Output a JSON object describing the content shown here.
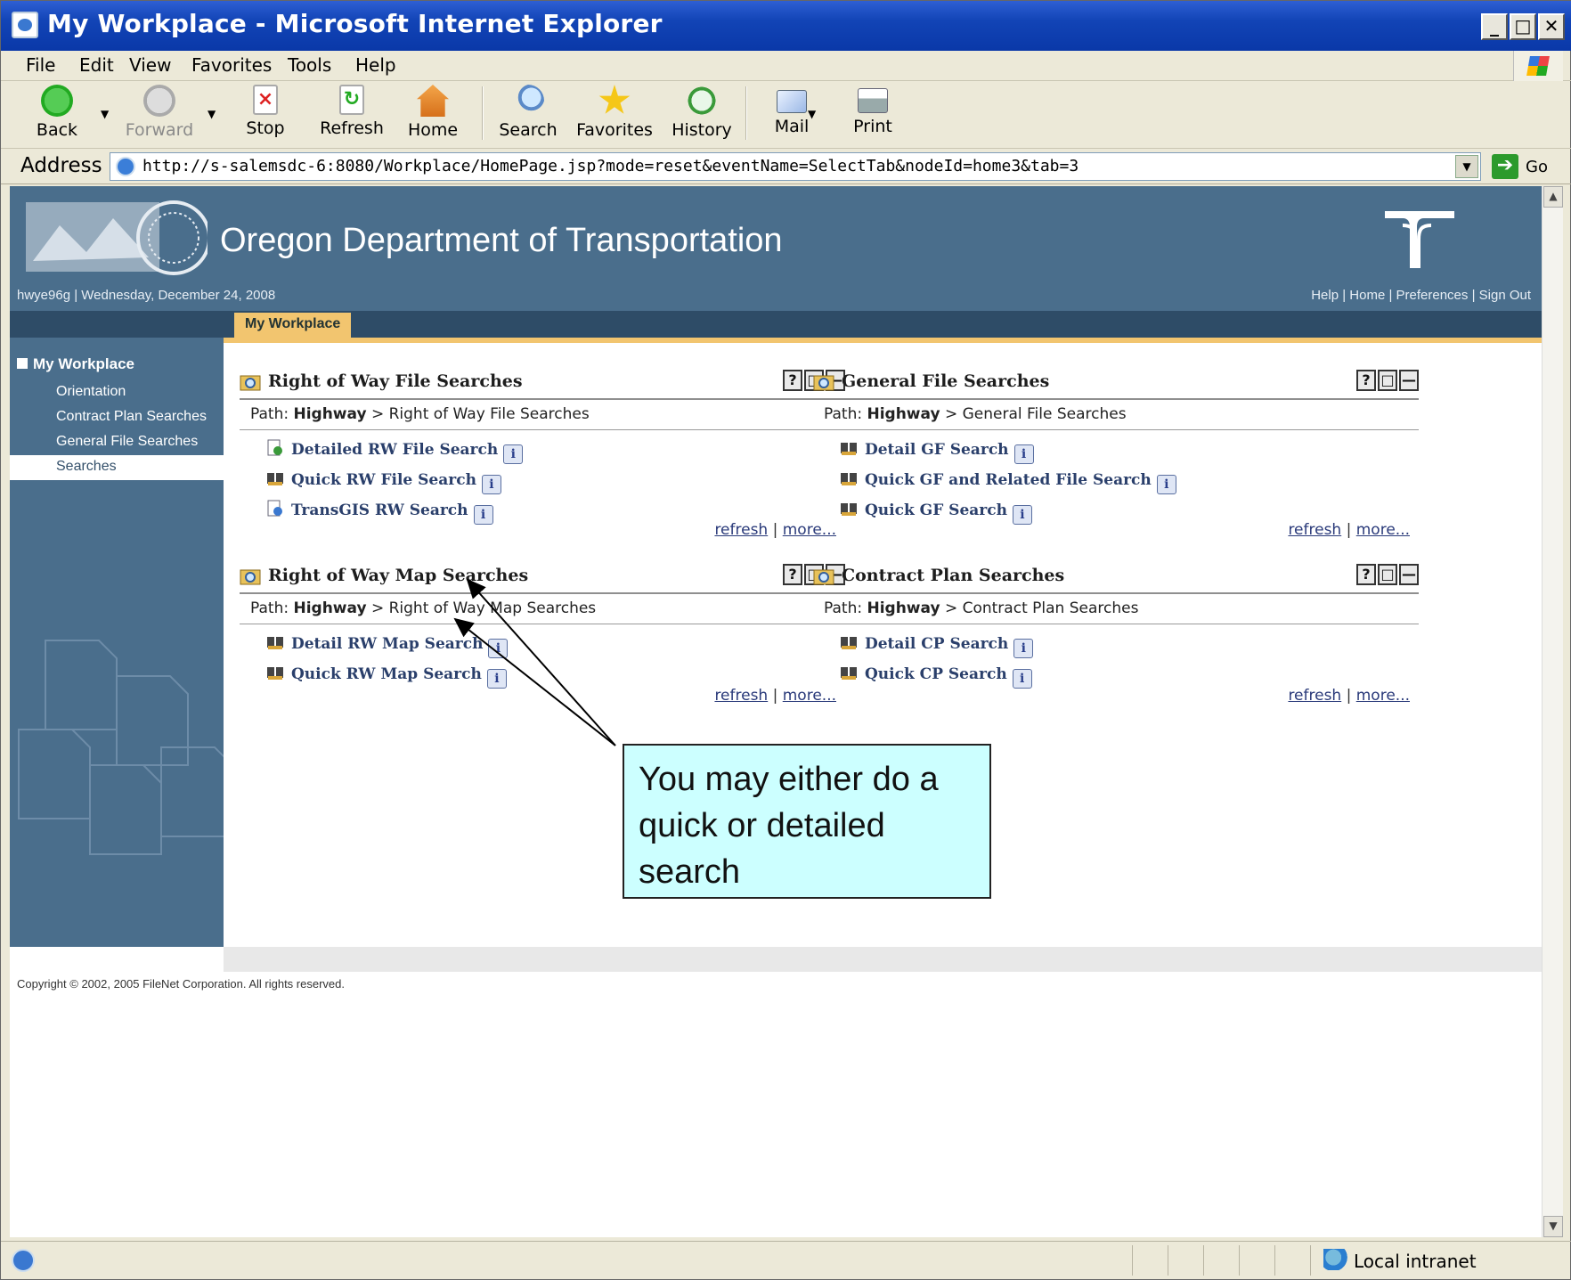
{
  "window": {
    "title": "My Workplace - Microsoft Internet Explorer"
  },
  "menubar": {
    "items": [
      "File",
      "Edit",
      "View",
      "Favorites",
      "Tools",
      "Help"
    ]
  },
  "toolbar": {
    "back": "Back",
    "forward": "Forward",
    "stop": "Stop",
    "refresh": "Refresh",
    "home": "Home",
    "search": "Search",
    "favorites": "Favorites",
    "history": "History",
    "mail": "Mail",
    "print": "Print"
  },
  "address": {
    "label": "Address",
    "url": "http://s-salemsdc-6:8080/Workplace/HomePage.jsp?mode=reset&eventName=SelectTab&nodeId=home3&tab=3",
    "go": "Go"
  },
  "header": {
    "org": "Oregon Department of Transportation",
    "user_line": "hwye96g | Wednesday, December 24, 2008",
    "links": "Help | Home | Preferences | Sign Out",
    "tab": "My Workplace"
  },
  "nav": {
    "title": "My Workplace",
    "items": [
      "Orientation",
      "Contract Plan Searches",
      "General File Searches",
      "Searches"
    ],
    "selected": "Searches"
  },
  "portlets": [
    {
      "title": "Right of Way File Searches",
      "path_bold": "Highway",
      "path_rest": " > Right of Way File Searches",
      "links": [
        "Detailed RW File Search",
        "Quick RW File Search",
        "TransGIS RW Search"
      ]
    },
    {
      "title": "General File Searches",
      "path_bold": "Highway",
      "path_rest": " > General File Searches",
      "links": [
        "Detail GF Search",
        "Quick GF and Related File Search",
        "Quick GF Search"
      ]
    },
    {
      "title": "Right of Way Map Searches",
      "path_bold": "Highway",
      "path_rest": " > Right of Way Map Searches",
      "links": [
        "Detail RW Map Search",
        "Quick RW Map Search"
      ]
    },
    {
      "title": "Contract Plan Searches",
      "path_bold": "Highway",
      "path_rest": " > Contract Plan Searches",
      "links": [
        "Detail CP Search",
        "Quick CP Search"
      ]
    }
  ],
  "portlet_common": {
    "path_label": "Path: ",
    "refresh": "refresh",
    "more": "more...",
    "sep": " | "
  },
  "footer": {
    "copyright": "Copyright © 2002, 2005 FileNet Corporation. All rights reserved."
  },
  "callout": {
    "text": "You may either do a quick or  detailed search"
  },
  "status": {
    "zone": "Local intranet"
  },
  "colors": {
    "header_blue": "#4a6e8c",
    "tab_gold": "#f2c56f",
    "callout_bg": "#ccffff",
    "titlebar_blue": "#0a38a8"
  }
}
